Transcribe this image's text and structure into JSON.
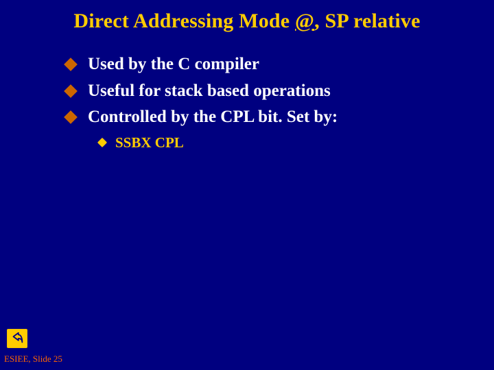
{
  "title": {
    "prefix": "Direct Addressing Mode ",
    "at": "@",
    "suffix": ", SP relative"
  },
  "bullets": [
    "Used by the C compiler",
    "Useful for stack based operations",
    "Controlled by the CPL bit. Set by:"
  ],
  "sub": {
    "text": "SSBX CPL"
  },
  "footer": "ESIEE, Slide 25",
  "icons": {
    "action": "return-arrow-icon"
  },
  "colors": {
    "bg": "#000080",
    "accent": "#ffcc00",
    "bullet": "#cc6600",
    "footer": "#ff6600"
  }
}
